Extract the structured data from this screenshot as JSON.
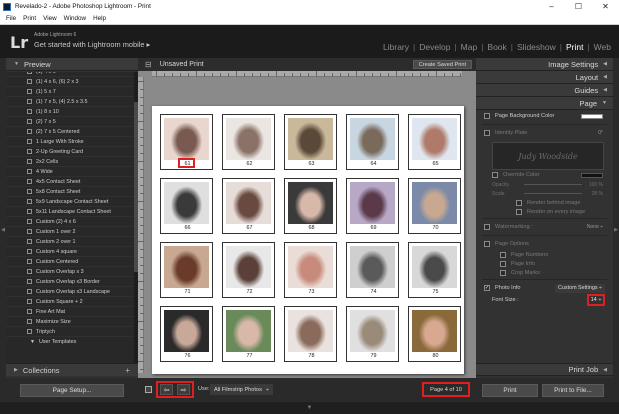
{
  "window": {
    "title": "Revelado-2 - Adobe Photoshop Lightroom - Print",
    "controls": [
      "–",
      "☐",
      "✕"
    ]
  },
  "menubar": [
    "File",
    "Print",
    "View",
    "Window",
    "Help"
  ],
  "identity": {
    "logo": "Lr",
    "line1": "Adobe Lightroom 6",
    "line2": "Get started with Lightroom mobile ▸"
  },
  "modules": [
    "Library",
    "Develop",
    "Map",
    "Book",
    "Slideshow",
    "Print",
    "Web"
  ],
  "active_module": "Print",
  "left_panel": {
    "preview_label": "Preview",
    "templates": [
      "(1) 4 x 6",
      "(1) 4 x 6, (6) 2 x 3",
      "(1) 5 x 7",
      "(1) 7 x 5, (4) 2.5 x 3.5",
      "(1) 8 x 10",
      "(2) 7 x 5",
      "(2) 7 x 5 Centered",
      "1 Large With Stroke",
      "2-Up Greeting Card",
      "2x2 Cells",
      "4 Wide",
      "4x5 Contact Sheet",
      "5x8 Contact Sheet",
      "5x9 Landscape Contact Sheet",
      "5x11 Landscape Contact Sheet",
      "Custom (2) 4 x 6",
      "Custom 1 over 2",
      "Custom 2 over 1",
      "Custom 4 square",
      "Custom Centered",
      "Custom Overlap x 3",
      "Custom Overlap x3 Border",
      "Custom Overlap x3 Landscape",
      "Custom Square + 2",
      "Fine Art Mat",
      "Maximize Size",
      "Triptych"
    ],
    "user_templates_label": "User Templates",
    "collections_label": "Collections",
    "page_setup_label": "Page Setup..."
  },
  "center": {
    "unsaved_label": "Unsaved Print",
    "create_saved_label": "Create Saved Print",
    "photos": [
      {
        "num": "61",
        "c1": "#e8d6cf",
        "c2": "#7a5a50"
      },
      {
        "num": "62",
        "c1": "#ece6e2",
        "c2": "#8a7268"
      },
      {
        "num": "63",
        "c1": "#c9b89a",
        "c2": "#5a4838"
      },
      {
        "num": "64",
        "c1": "#c8d6e2",
        "c2": "#7a6a5c"
      },
      {
        "num": "65",
        "c1": "#dfe6ef",
        "c2": "#b07a6a"
      },
      {
        "num": "66",
        "c1": "#dfdfdf",
        "c2": "#3a3a3a"
      },
      {
        "num": "67",
        "c1": "#e6dcd8",
        "c2": "#6a4a40"
      },
      {
        "num": "68",
        "c1": "#3a3a3a",
        "c2": "#d8b8a8"
      },
      {
        "num": "69",
        "c1": "#b8a8c8",
        "c2": "#5a3a4a"
      },
      {
        "num": "70",
        "c1": "#7a8aa8",
        "c2": "#c8a890"
      },
      {
        "num": "71",
        "c1": "#c8a890",
        "c2": "#6a3a2a"
      },
      {
        "num": "72",
        "c1": "#e8e8e8",
        "c2": "#5a4038"
      },
      {
        "num": "73",
        "c1": "#eadcd6",
        "c2": "#c88a7a"
      },
      {
        "num": "74",
        "c1": "#cfcfcf",
        "c2": "#5a5a5a"
      },
      {
        "num": "75",
        "c1": "#d8d8d8",
        "c2": "#4a4a4a"
      },
      {
        "num": "76",
        "c1": "#2a2a2a",
        "c2": "#c8a898"
      },
      {
        "num": "77",
        "c1": "#6a8a5a",
        "c2": "#d8b8a8"
      },
      {
        "num": "78",
        "c1": "#eae2de",
        "c2": "#8a6a5a"
      },
      {
        "num": "79",
        "c1": "#e0e0e0",
        "c2": "#9a8a7a"
      },
      {
        "num": "80",
        "c1": "#8a6a3a",
        "c2": "#d8a890"
      }
    ],
    "use_label": "Use:",
    "use_value": "All Filmstrip Photos",
    "page_indicator": "Page 4 of 10",
    "prev_arrow": "⇦",
    "next_arrow": "⇨"
  },
  "right_panel": {
    "image_settings": "Image Settings",
    "layout": "Layout",
    "guides": "Guides",
    "page": "Page",
    "page_bg_color": "Page Background Color",
    "identity_plate": "Identity Plate",
    "identity_plate_rotation": "0°",
    "identity_plate_text": "Judy Woodside",
    "override_color": "Override Color",
    "opacity_label": "Opacity",
    "opacity_value": "100 %",
    "scale_label": "Scale",
    "scale_value": "28 %",
    "render_behind": "Render behind image",
    "render_every": "Render on every image",
    "watermarking": "Watermarking :",
    "watermark_value": "None ÷",
    "page_options": "Page Options",
    "page_numbers": "Page Numbers",
    "page_info": "Page Info",
    "crop_marks": "Crop Marks",
    "photo_info": "Photo Info",
    "photo_info_value": "Custom Settings ÷",
    "font_size_label": "Font Size :",
    "font_size_value": "14 ÷",
    "print_job": "Print Job",
    "print_btn": "Print",
    "print_to_file_btn": "Print to File..."
  }
}
